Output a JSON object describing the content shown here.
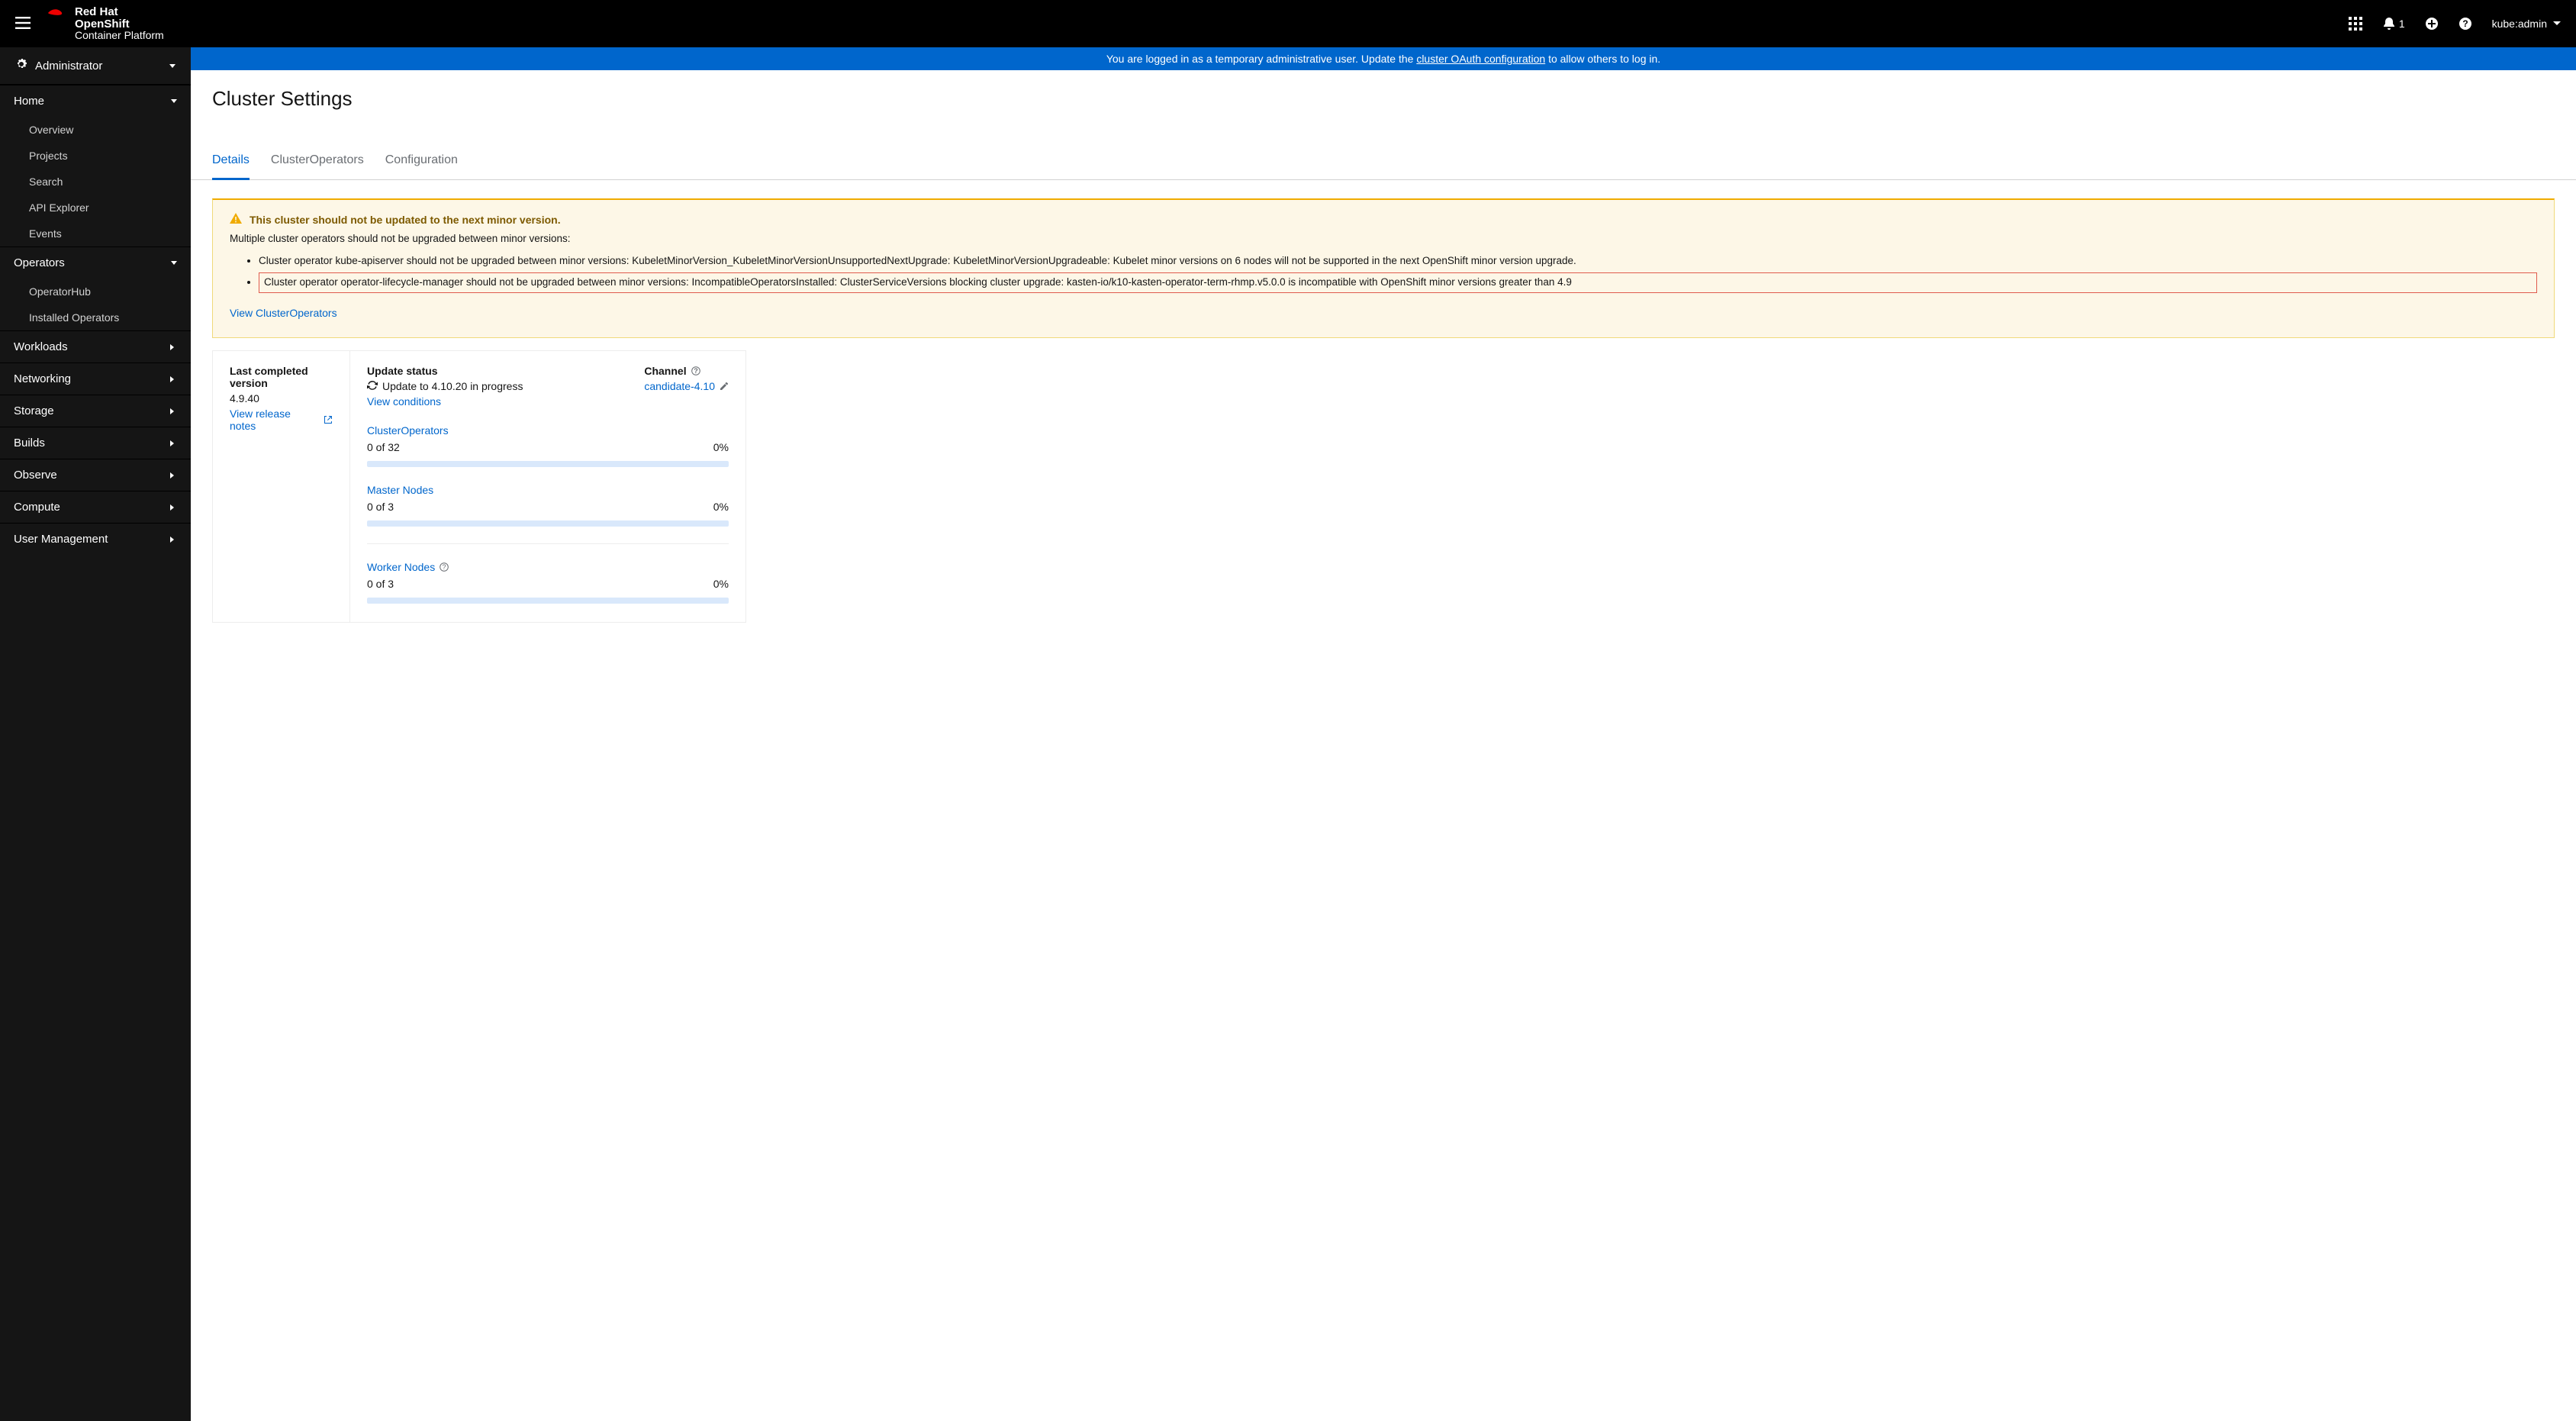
{
  "masthead": {
    "product_line1": "Red Hat",
    "product_line2": "OpenShift",
    "product_line3": "Container Platform",
    "notif_count": "1",
    "user": "kube:admin"
  },
  "banner": {
    "pre": "You are logged in as a temporary administrative user. Update the ",
    "link": "cluster OAuth configuration",
    "post": " to allow others to log in."
  },
  "perspective": "Administrator",
  "sidebar": {
    "home": {
      "label": "Home",
      "items": [
        "Overview",
        "Projects",
        "Search",
        "API Explorer",
        "Events"
      ]
    },
    "operators": {
      "label": "Operators",
      "items": [
        "OperatorHub",
        "Installed Operators"
      ]
    },
    "rest": [
      "Workloads",
      "Networking",
      "Storage",
      "Builds",
      "Observe",
      "Compute",
      "User Management"
    ]
  },
  "page_title": "Cluster Settings",
  "tabs": [
    "Details",
    "ClusterOperators",
    "Configuration"
  ],
  "alert": {
    "title": "This cluster should not be updated to the next minor version.",
    "intro": "Multiple cluster operators should not be upgraded between minor versions:",
    "bullets": [
      "Cluster operator kube-apiserver should not be upgraded between minor versions: KubeletMinorVersion_KubeletMinorVersionUnsupportedNextUpgrade: KubeletMinorVersionUpgradeable: Kubelet minor versions on 6 nodes will not be supported in the next OpenShift minor version upgrade.",
      "Cluster operator operator-lifecycle-manager should not be upgraded between minor versions: IncompatibleOperatorsInstalled: ClusterServiceVersions blocking cluster upgrade: kasten-io/k10-kasten-operator-term-rhmp.v5.0.0 is incompatible with OpenShift minor versions greater than 4.9"
    ],
    "link": "View ClusterOperators"
  },
  "details": {
    "last_label": "Last completed version",
    "last_value": "4.9.40",
    "release_notes": "View release notes",
    "update_status_label": "Update status",
    "update_status_value": "Update to 4.10.20 in progress",
    "view_conditions": "View conditions",
    "channel_label": "Channel",
    "channel_value": "candidate-4.10",
    "progress": [
      {
        "title": "ClusterOperators",
        "count": "0 of 32",
        "pct": "0%"
      },
      {
        "title": "Master Nodes",
        "count": "0 of 3",
        "pct": "0%"
      },
      {
        "title": "Worker Nodes",
        "count": "0 of 3",
        "pct": "0%",
        "help": true
      }
    ]
  }
}
